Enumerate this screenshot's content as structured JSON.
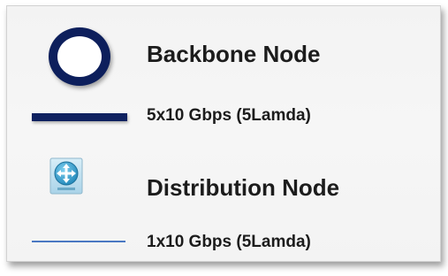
{
  "legend": {
    "items": [
      {
        "symbol": "backbone-node-circle-icon",
        "label": "Backbone Node"
      },
      {
        "symbol": "thick-navy-line",
        "label": "5x10 Gbps (5Lamda)"
      },
      {
        "symbol": "distribution-router-icon",
        "label": "Distribution Node"
      },
      {
        "symbol": "thin-blue-line",
        "label": "1x10 Gbps (5Lamda)"
      }
    ]
  },
  "colors": {
    "backbone": "#0d1f5c",
    "thick_line": "#0f2160",
    "thin_line": "#4a78c2",
    "router_icon": "#2b9fcf",
    "text": "#1c1c1c"
  }
}
